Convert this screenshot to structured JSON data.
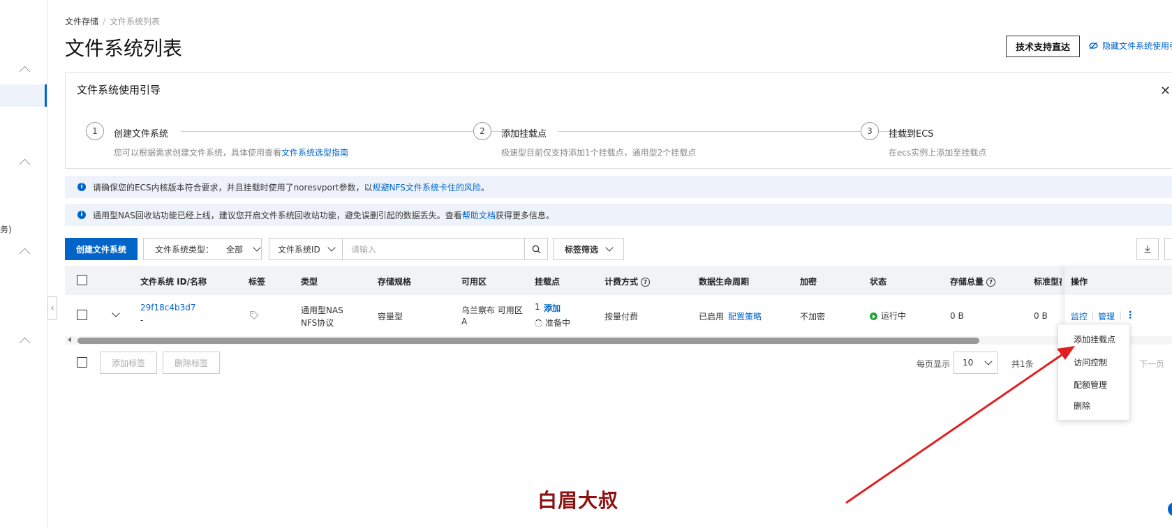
{
  "breadcrumb": {
    "parent": "文件存储",
    "current": "文件系统列表"
  },
  "page_title": "文件系统列表",
  "header": {
    "support_label": "技术支持直达",
    "hide_guide_label": "隐藏文件系统使用引"
  },
  "sidebar": {
    "partial_text": "务)"
  },
  "guide": {
    "title": "文件系统使用引导",
    "steps": [
      {
        "num": "1",
        "title": "创建文件系统",
        "desc": "您可以根据需求创建文件系统，具体使用查看",
        "link": "文件系统选型指南"
      },
      {
        "num": "2",
        "title": "添加挂载点",
        "desc": "极速型目前仅支持添加1个挂载点，通用型2个挂载点"
      },
      {
        "num": "3",
        "title": "挂载到ECS",
        "desc": "在ecs实例上添加至挂载点"
      }
    ]
  },
  "notices": [
    {
      "text": "请确保您的ECS内核版本符合要求，并且挂载时使用了noresvport参数，以",
      "link": "规避NFS文件系统卡住的风险",
      "suffix": "。"
    },
    {
      "text": "通用型NAS回收站功能已经上线，建议您开启文件系统回收站功能，避免误删引起的数据丢失。查看",
      "link": "帮助文档",
      "suffix": "获得更多信息。"
    }
  ],
  "toolbar": {
    "create_label": "创建文件系统",
    "type_filter_label": "文件系统类型：",
    "type_filter_value": "全部",
    "id_select_label": "文件系统ID",
    "search_placeholder": "请输入",
    "tag_filter_label": "标签筛选"
  },
  "table": {
    "headers": {
      "id_name": "文件系统 ID/名称",
      "tag": "标签",
      "type": "类型",
      "spec": "存储规格",
      "zone": "可用区",
      "mount": "挂载点",
      "billing": "计费方式",
      "lifecycle": "数据生命周期",
      "encrypt": "加密",
      "status": "状态",
      "total": "存储总量",
      "standard": "标准型存",
      "ops": "操作"
    },
    "row": {
      "id": "29f18c4b3d7",
      "name": "-",
      "type_line1": "通用型NAS",
      "type_line2": "NFS协议",
      "spec": "容量型",
      "zone_line1": "乌兰察布 可用区",
      "zone_line2": "A",
      "mount_count": "1",
      "mount_add": "添加",
      "mount_status": "准备中",
      "billing": "按量付费",
      "lifecycle": "已启用",
      "lifecycle_link": "配置策略",
      "encrypt": "不加密",
      "status": "运行中",
      "total": "0 B",
      "standard": "0 B",
      "op_monitor": "监控",
      "op_manage": "管理",
      "op_more": "⋮"
    }
  },
  "footer": {
    "add_tag": "添加标签",
    "remove_tag": "删除标签",
    "page_size_label": "每页显示",
    "page_size": "10",
    "total": "共1条",
    "next": "下一页"
  },
  "menu": {
    "items": [
      "添加挂载点",
      "访问控制",
      "配额管理",
      "删除"
    ]
  },
  "watermark": "白眉大叔",
  "colors": {
    "primary": "#0064c8",
    "annotation": "#e02020",
    "status_running": "#21a33b"
  }
}
